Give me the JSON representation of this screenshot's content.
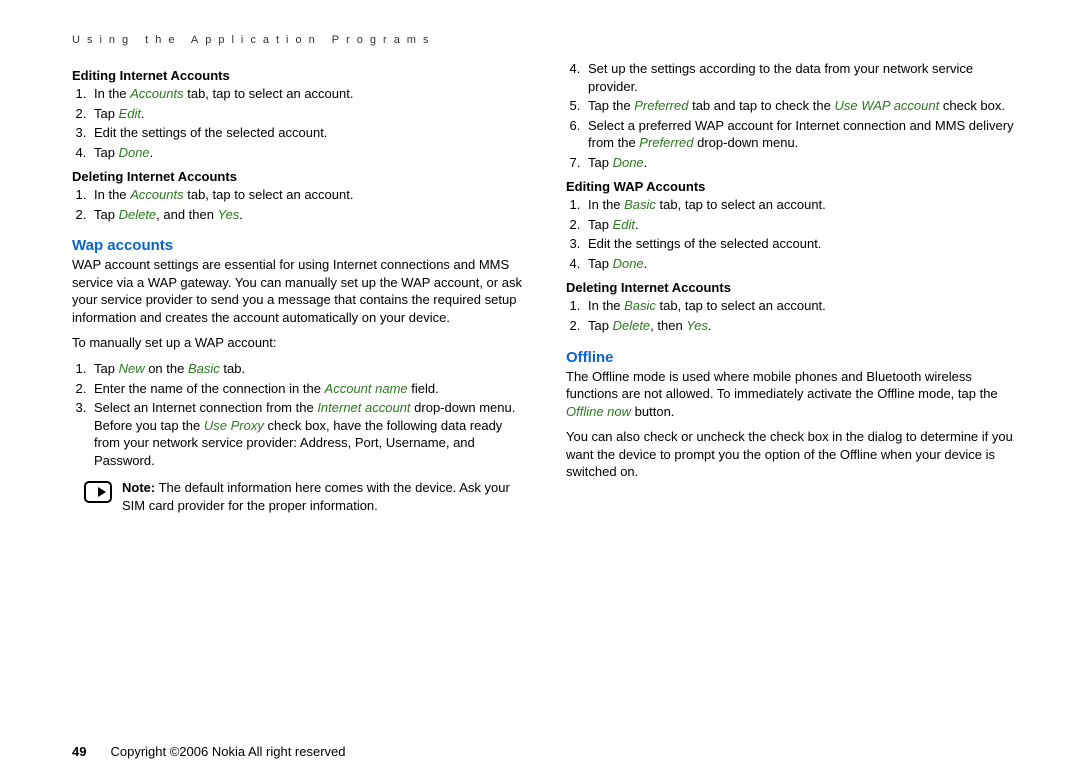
{
  "header": "Using the Application Programs",
  "left": {
    "editing_title": "Editing Internet Accounts",
    "editing_steps": {
      "s1a": "In the ",
      "s1b": "Accounts",
      "s1c": " tab, tap to select an account.",
      "s2a": "Tap ",
      "s2b": "Edit",
      "s2c": ".",
      "s3": "Edit the settings of the selected account.",
      "s4a": "Tap ",
      "s4b": "Done",
      "s4c": "."
    },
    "deleting_title": "Deleting Internet Accounts",
    "deleting_steps": {
      "s1a": "In the ",
      "s1b": "Accounts",
      "s1c": " tab, tap to select an account.",
      "s2a": "Tap ",
      "s2b": "Delete",
      "s2c": ", and then ",
      "s2d": "Yes",
      "s2e": "."
    },
    "wap_title": "Wap accounts",
    "wap_intro": "WAP account settings are essential for using Internet connections and MMS service via a WAP gateway. You can manually set up the WAP account, or ask your service provider to send you a message that contains the required setup information and creates the account automatically on your device.",
    "wap_setup_lead": "To manually set up a WAP account:",
    "wap_steps": {
      "s1a": "Tap ",
      "s1b": "New",
      "s1c": " on the ",
      "s1d": "Basic",
      "s1e": " tab.",
      "s2a": "Enter the name of the connection in the ",
      "s2b": "Account name",
      "s2c": " field.",
      "s3a": "Select an Internet connection from the ",
      "s3b": "Internet account",
      "s3c": " drop-down menu. Before you tap the ",
      "s3d": "Use Proxy",
      "s3e": " check box, have the following data ready from your network service provider: Address, Port, Username, and Password."
    },
    "note_label": "Note:",
    "note_text": " The default information here comes with the device. Ask your SIM card provider for the proper information."
  },
  "right": {
    "cont_steps": {
      "s4": "Set up the settings according to the data from your network service provider.",
      "s5a": "Tap the ",
      "s5b": "Preferred",
      "s5c": " tab and tap to check the ",
      "s5d": "Use WAP account",
      "s5e": " check box.",
      "s6a": "Select a preferred WAP account for Internet connection and MMS delivery from the ",
      "s6b": "Preferred",
      "s6c": " drop-down menu.",
      "s7a": "Tap ",
      "s7b": "Done",
      "s7c": "."
    },
    "editwap_title": "Editing WAP Accounts",
    "editwap_steps": {
      "s1a": "In the ",
      "s1b": "Basic",
      "s1c": " tab, tap to select an account.",
      "s2a": "Tap ",
      "s2b": "Edit",
      "s2c": ".",
      "s3": "Edit the settings of the selected account.",
      "s4a": "Tap ",
      "s4b": "Done",
      "s4c": "."
    },
    "del2_title": "Deleting Internet Accounts",
    "del2_steps": {
      "s1a": "In the ",
      "s1b": "Basic",
      "s1c": " tab, tap to select an account.",
      "s2a": "Tap ",
      "s2b": "Delete",
      "s2c": ", then ",
      "s2d": "Yes",
      "s2e": "."
    },
    "offline_title": "Offline",
    "offline_p1a": "The Offline mode is used where mobile phones and Bluetooth wireless functions are not allowed. To immediately activate the Offline mode, tap the ",
    "offline_p1b": "Offline now",
    "offline_p1c": " button.",
    "offline_p2": "You can also check or uncheck the check box in the dialog to determine if you want the device to prompt you the option of the Offline when your device is switched on."
  },
  "footer": {
    "page": "49",
    "copyright": "Copyright ©2006 Nokia All right reserved"
  }
}
